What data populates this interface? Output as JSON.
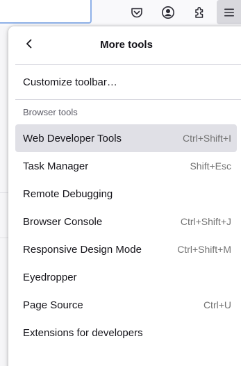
{
  "toolbar": {
    "icons": [
      "pocket-icon",
      "account-icon",
      "extensions-icon",
      "menu-icon"
    ]
  },
  "panel": {
    "title": "More tools",
    "customize_label": "Customize toolbar…",
    "section_label": "Browser tools",
    "items": [
      {
        "label": "Web Developer Tools",
        "shortcut": "Ctrl+Shift+I",
        "active": true
      },
      {
        "label": "Task Manager",
        "shortcut": "Shift+Esc"
      },
      {
        "label": "Remote Debugging",
        "shortcut": ""
      },
      {
        "label": "Browser Console",
        "shortcut": "Ctrl+Shift+J"
      },
      {
        "label": "Responsive Design Mode",
        "shortcut": "Ctrl+Shift+M"
      },
      {
        "label": "Eyedropper",
        "shortcut": ""
      },
      {
        "label": "Page Source",
        "shortcut": "Ctrl+U"
      },
      {
        "label": "Extensions for developers",
        "shortcut": ""
      }
    ]
  },
  "colors": {
    "active_item_bg": "#e0e0e6",
    "menu_button_bg": "#d8d8dd",
    "urlbar_focus": "#8fb1e8",
    "shortcut_text": "#737373"
  }
}
